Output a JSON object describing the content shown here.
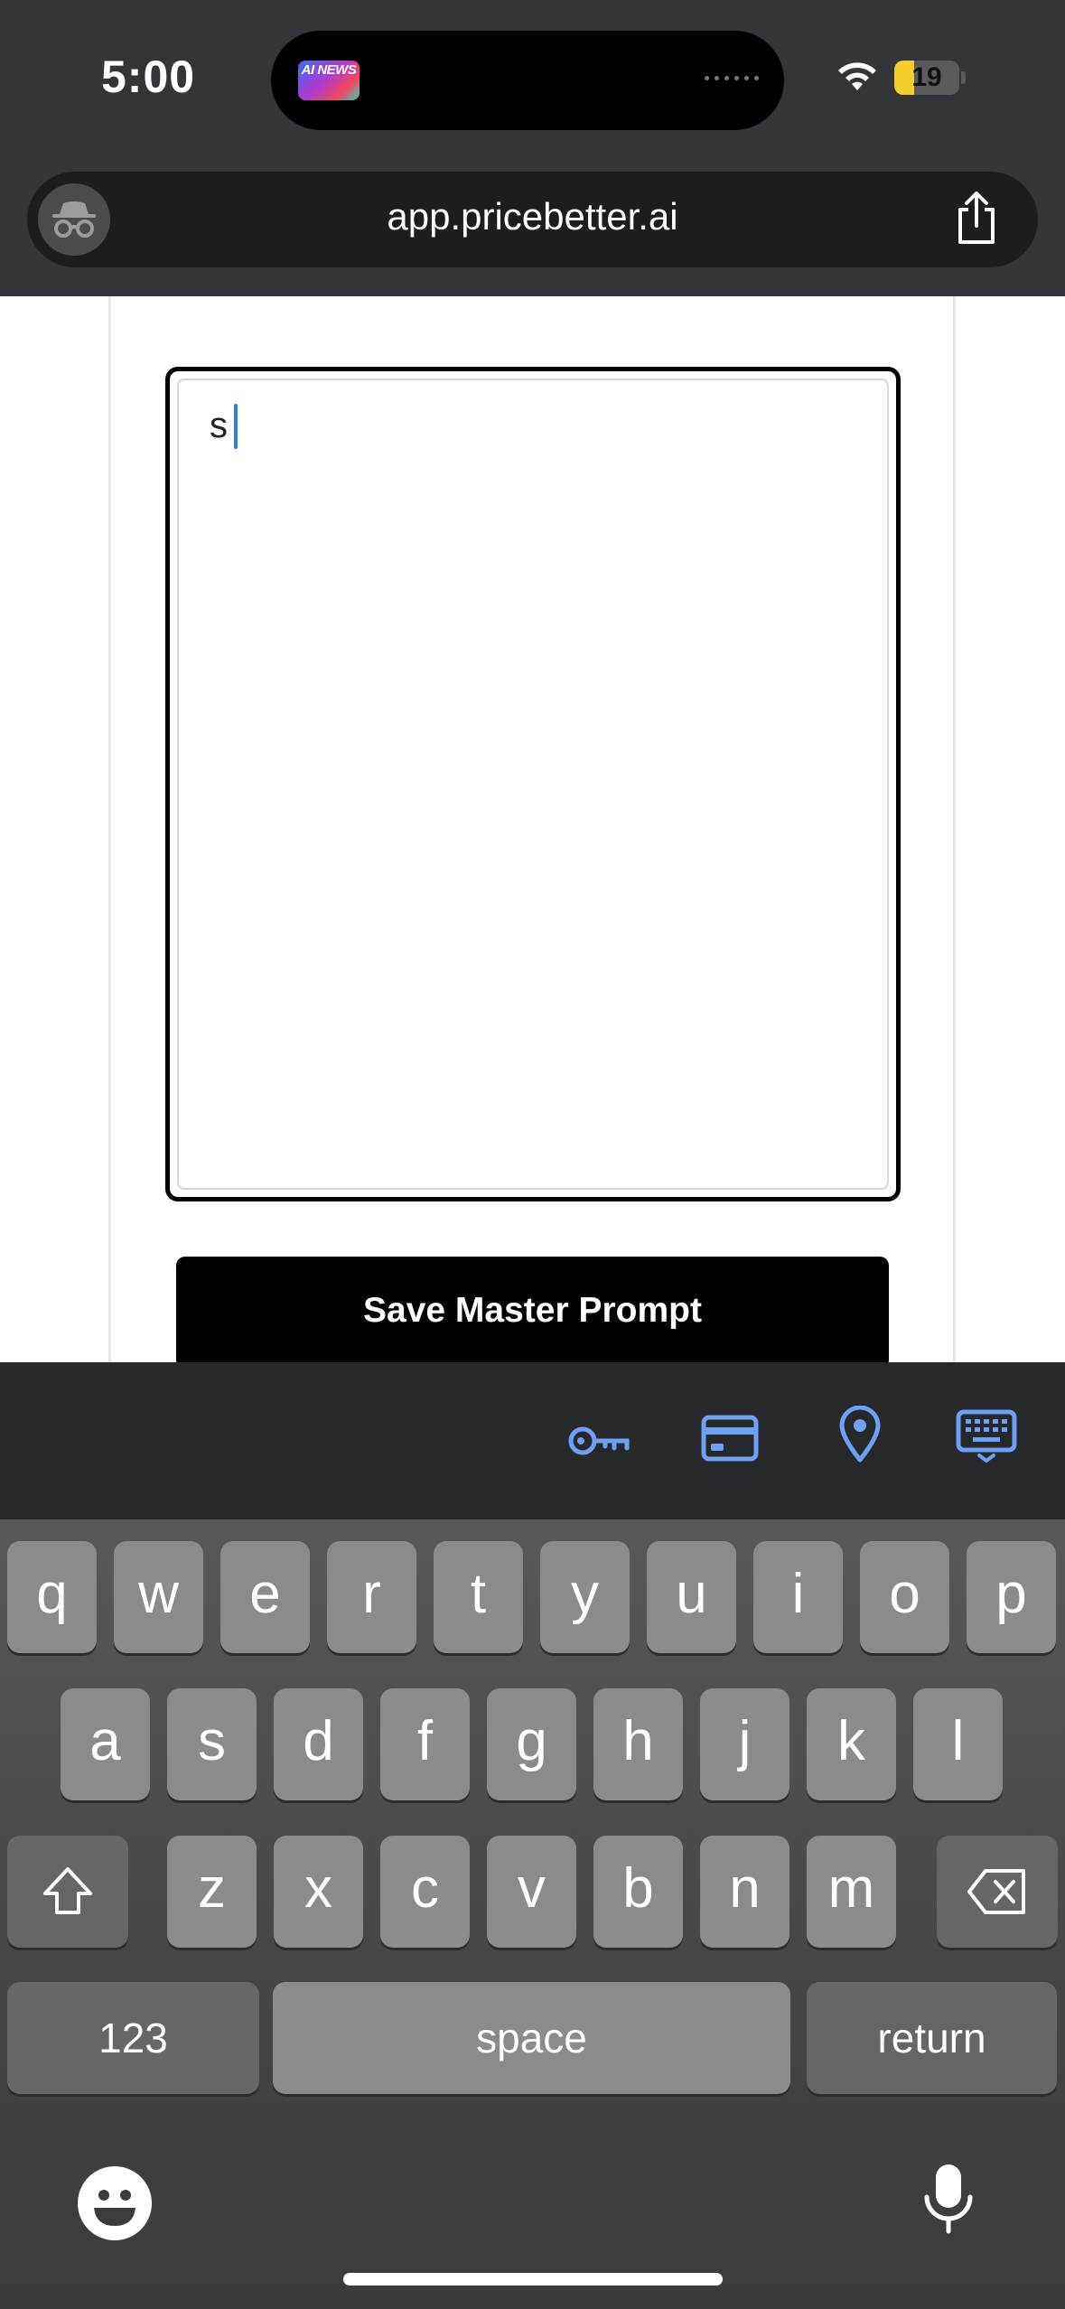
{
  "status_bar": {
    "time": "5:00",
    "island_app_label": "AI NEWS",
    "battery_level": "19",
    "battery_fraction": 0.19,
    "icons": [
      "wifi-icon",
      "battery-icon"
    ]
  },
  "browser": {
    "url": "app.pricebetter.ai",
    "icons": [
      "incognito-icon",
      "share-icon"
    ]
  },
  "editor": {
    "text_value": "s",
    "save_label": "Save Master Prompt"
  },
  "keyboard": {
    "accessory_icons": [
      "key-icon",
      "credit-card-icon",
      "location-pin-icon",
      "keyboard-icon"
    ],
    "row1": [
      "q",
      "w",
      "e",
      "r",
      "t",
      "y",
      "u",
      "i",
      "o",
      "p"
    ],
    "row2": [
      "a",
      "s",
      "d",
      "f",
      "g",
      "h",
      "j",
      "k",
      "l"
    ],
    "row3": [
      "z",
      "x",
      "c",
      "v",
      "b",
      "n",
      "m"
    ],
    "numbers_label": "123",
    "space_label": "space",
    "return_label": "return",
    "accent_color": "#6fa0f2"
  }
}
